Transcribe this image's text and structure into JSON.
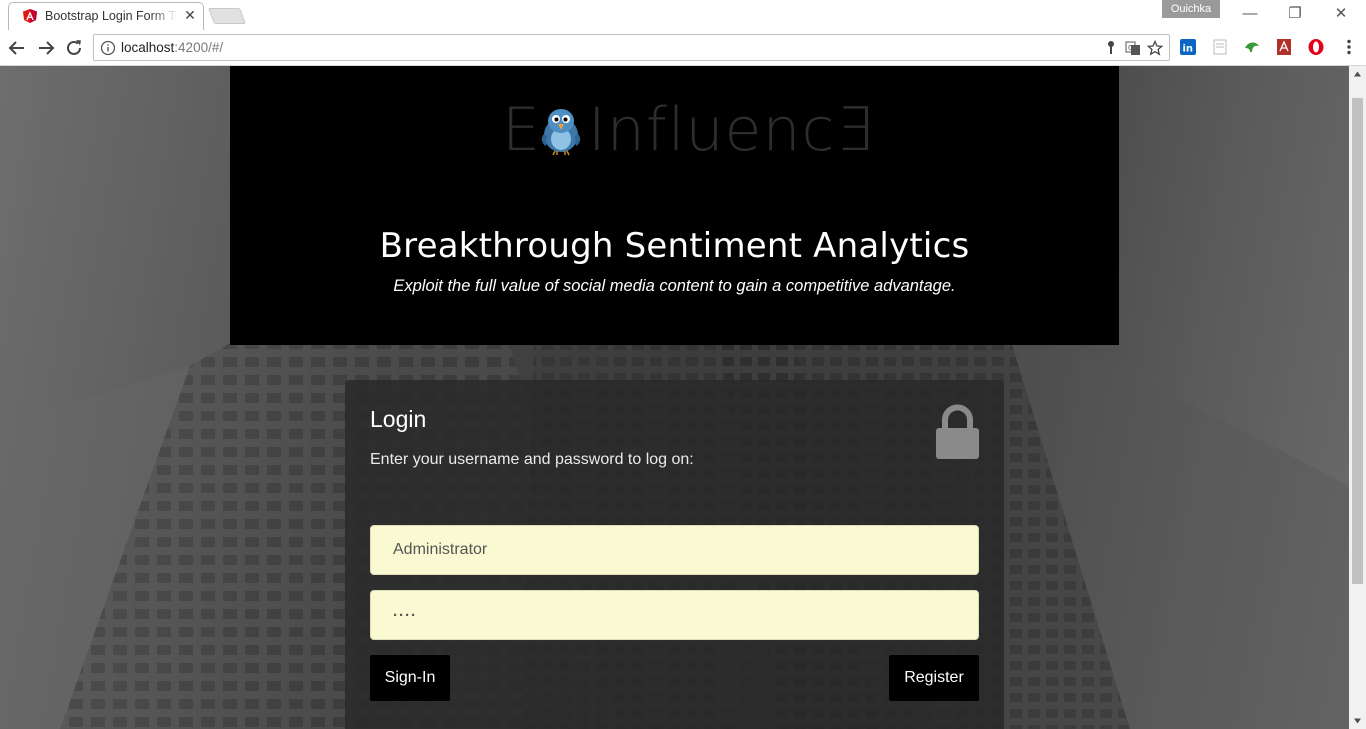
{
  "browser": {
    "tab_title": "Bootstrap Login Form Te",
    "tab_close": "✕",
    "profile_name": "Ouichka",
    "url_host": "localhost",
    "url_rest": ":4200/#/",
    "window_controls": {
      "minimize": "—",
      "restore": "❐",
      "close": "✕"
    },
    "icons": [
      "back-icon",
      "forward-icon",
      "reload-icon",
      "info-icon",
      "key-icon",
      "translate-icon",
      "star-icon",
      "linkedin-icon",
      "reader-icon",
      "leaf-extension-icon",
      "pdf-icon",
      "opera-icon",
      "menu-icon"
    ]
  },
  "hero": {
    "logo_prefix": "E",
    "logo_suffix": "Influenc∃",
    "title": "Breakthrough Sentiment Analytics",
    "subtitle": "Exploit the full value of social media content to gain a competitive advantage."
  },
  "login": {
    "title": "Login",
    "description": "Enter your username and password to log on:",
    "username_value": "Administrator",
    "password_value": "····",
    "signin_label": "Sign-In",
    "register_label": "Register"
  },
  "colors": {
    "accent_black": "#000000",
    "field_bg": "#fafad2",
    "panel_bg": "rgba(40,40,40,0.82)"
  }
}
